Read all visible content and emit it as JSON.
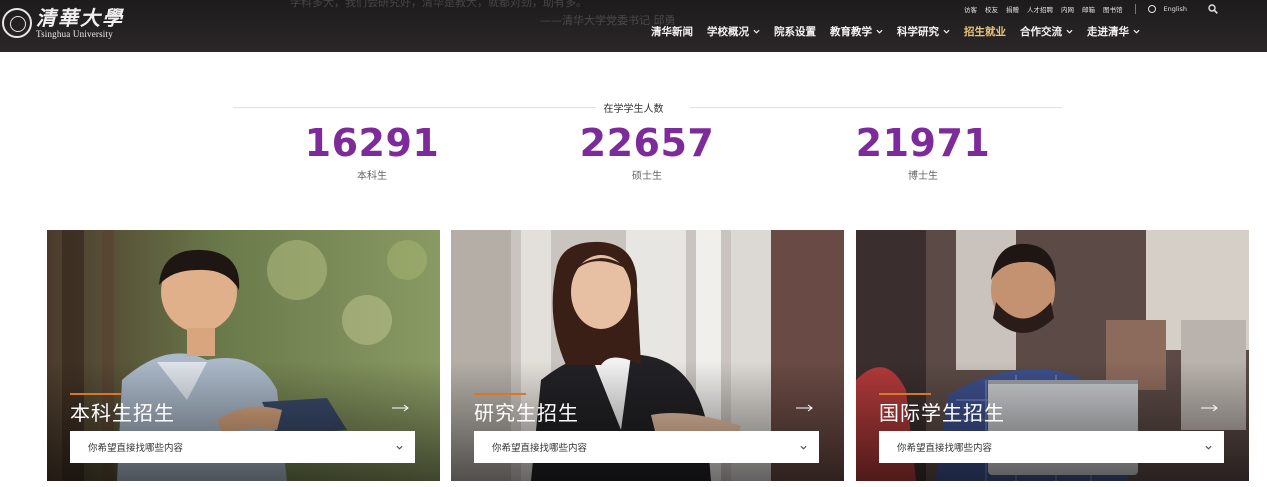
{
  "header": {
    "logo_cn": "清華大學",
    "logo_en": "Tsinghua University",
    "bg_quote_line1": "学科多大，我们会研究好，清华是教大，就都对劲，助有多。",
    "bg_quote_line2": "——清华大学党委书记 邱勇",
    "utility_links": [
      "访客",
      "校友",
      "捐赠",
      "人才招聘",
      "内网",
      "邮箱",
      "图书馆"
    ],
    "language_label": "English",
    "nav": [
      {
        "label": "清华新闻",
        "has_dropdown": false
      },
      {
        "label": "学校概况",
        "has_dropdown": true
      },
      {
        "label": "院系设置",
        "has_dropdown": false
      },
      {
        "label": "教育教学",
        "has_dropdown": true
      },
      {
        "label": "科学研究",
        "has_dropdown": true
      },
      {
        "label": "招生就业",
        "has_dropdown": false,
        "active": true
      },
      {
        "label": "合作交流",
        "has_dropdown": true
      },
      {
        "label": "走进清华",
        "has_dropdown": true
      }
    ]
  },
  "stats": {
    "title": "在学学生人数",
    "items": [
      {
        "value": "16291",
        "label": "本科生"
      },
      {
        "value": "22657",
        "label": "硕士生"
      },
      {
        "value": "21971",
        "label": "博士生"
      }
    ]
  },
  "cards": [
    {
      "title": "本科生招生",
      "select_placeholder": "你希望直接找哪些内容"
    },
    {
      "title": "研究生招生",
      "select_placeholder": "你希望直接找哪些内容"
    },
    {
      "title": "国际学生招生",
      "select_placeholder": "你希望直接找哪些内容"
    }
  ],
  "colors": {
    "accent_purple": "#7d2a9a",
    "active_nav": "#e8c47a",
    "card_accent": "#d8762a",
    "header_bg": "#221f20"
  }
}
